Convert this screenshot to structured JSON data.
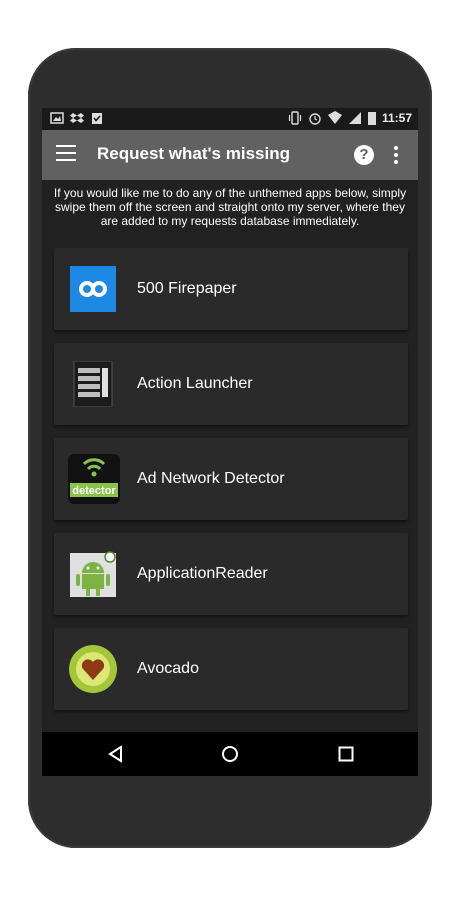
{
  "status_bar": {
    "time": "11:57",
    "left_icons": [
      "image-icon",
      "dropbox-icon",
      "clipboard-check-icon"
    ],
    "right_icons": [
      "vibrate-icon",
      "alarm-icon",
      "wifi-icon",
      "signal-icon",
      "battery-icon"
    ]
  },
  "toolbar": {
    "title": "Request what's missing",
    "menu_icon": "hamburger-menu-icon",
    "help_glyph": "?",
    "more_icon": "more-vert-icon"
  },
  "intro_text": "If you would like me to do any of the unthemed apps below, simply swipe them off the screen and straight onto my server, where they are added to my requests database immediately.",
  "apps": [
    {
      "name": "500 Firepaper",
      "icon": "firepaper-icon",
      "color": "#1e88e5"
    },
    {
      "name": "Action Launcher",
      "icon": "action-launcher-icon",
      "color": "#303030"
    },
    {
      "name": "Ad Network Detector",
      "icon": "ad-detector-icon",
      "color": "#8bc34a",
      "icon_text": "detector"
    },
    {
      "name": "ApplicationReader",
      "icon": "android-reader-icon",
      "color": "#7cb342"
    },
    {
      "name": "Avocado",
      "icon": "avocado-icon",
      "color": "#a4c639"
    }
  ],
  "nav_bar": {
    "back_icon": "back-triangle-icon",
    "home_icon": "home-circle-icon",
    "recents_icon": "recents-square-icon"
  }
}
